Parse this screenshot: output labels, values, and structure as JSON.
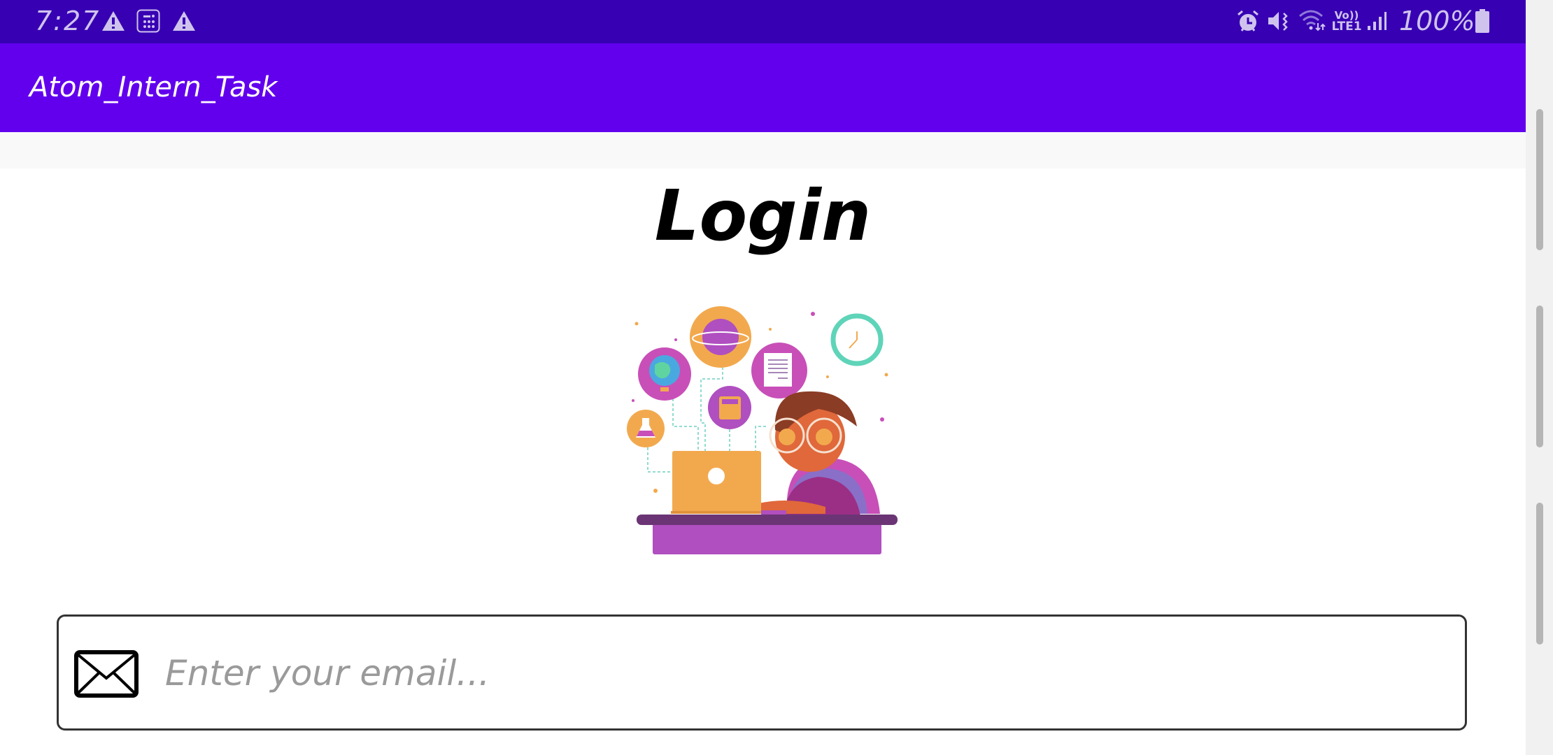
{
  "status_bar": {
    "time": "7:27",
    "left_icons": [
      "warning-icon",
      "calendar-grid-icon",
      "warning-icon"
    ],
    "right_icons": [
      "alarm-icon",
      "vibrate-icon",
      "wifi-icon",
      "volte-lte1-icon",
      "signal-icon"
    ],
    "volte_label": "Vo))",
    "lte_label": "LTE1",
    "battery": "100%",
    "battery_level": 100
  },
  "app_bar": {
    "title": "Atom_Intern_Task"
  },
  "main": {
    "title": "Login",
    "illustration": "student-at-laptop-illustration",
    "email": {
      "placeholder": "Enter your email...",
      "value": "",
      "icon": "envelope-icon"
    }
  },
  "colors": {
    "status_bar": "#3700b3",
    "app_bar": "#6200ee",
    "text": "#000000",
    "placeholder": "#9a9a9a"
  }
}
